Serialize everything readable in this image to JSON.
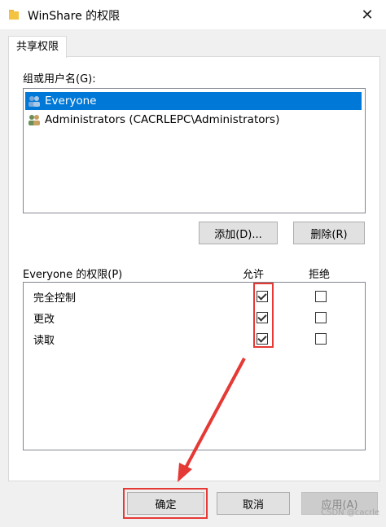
{
  "window": {
    "title": "WinShare 的权限",
    "close": "✕"
  },
  "tab": {
    "label": "共享权限"
  },
  "groups": {
    "label": "组或用户名(G):",
    "items": [
      {
        "name": "Everyone",
        "selected": true
      },
      {
        "name": "Administrators (CACRLEPC\\Administrators)",
        "selected": false
      }
    ]
  },
  "buttons": {
    "add": "添加(D)...",
    "remove": "删除(R)",
    "ok": "确定",
    "cancel": "取消",
    "apply": "应用(A)"
  },
  "permissions": {
    "label": "Everyone 的权限(P)",
    "allow_header": "允许",
    "deny_header": "拒绝",
    "rows": [
      {
        "name": "完全控制",
        "allow": true,
        "deny": false
      },
      {
        "name": "更改",
        "allow": true,
        "deny": false
      },
      {
        "name": "读取",
        "allow": true,
        "deny": false
      }
    ]
  },
  "watermark": "CSDN @cacrle",
  "colors": {
    "selection": "#0078d7",
    "annotation": "#e53935"
  }
}
